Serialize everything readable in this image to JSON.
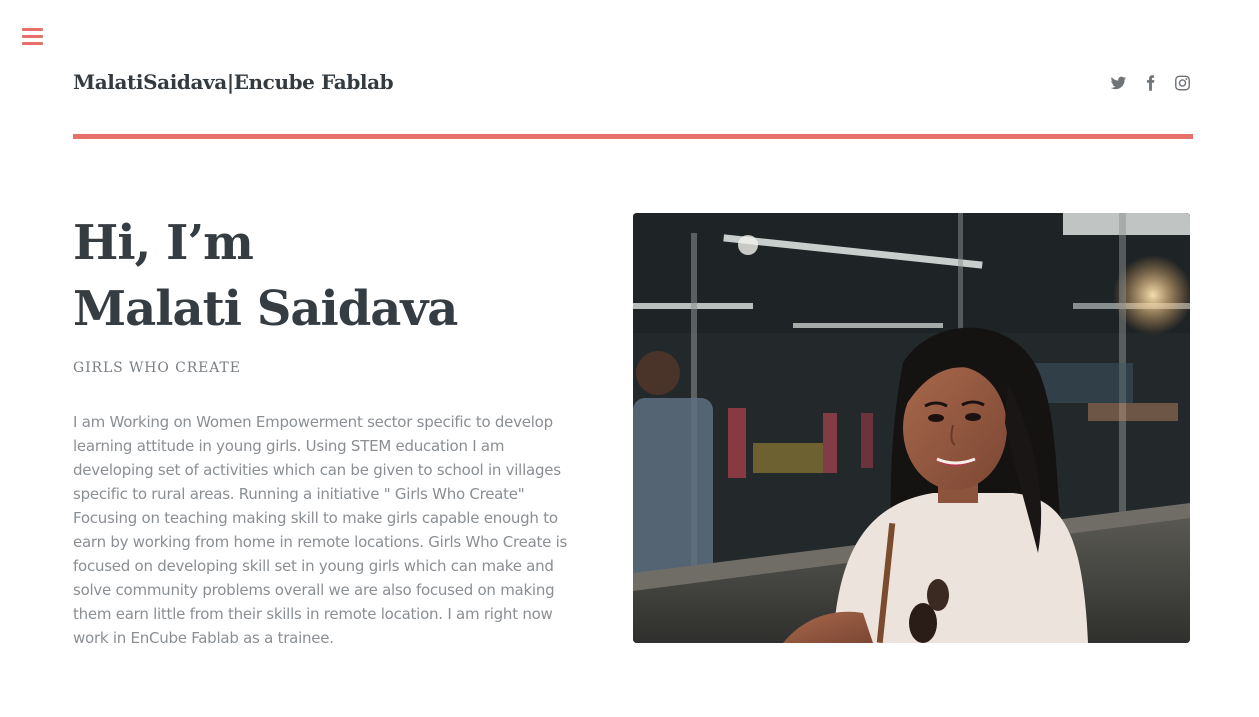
{
  "header": {
    "menu_icon": "hamburger-menu-icon",
    "site_title": "MalatiSaidava|Encube Fablab",
    "social_links": [
      {
        "icon": "twitter-icon",
        "label": "Twitter"
      },
      {
        "icon": "facebook-icon",
        "label": "Facebook"
      },
      {
        "icon": "instagram-icon",
        "label": "Instagram"
      }
    ]
  },
  "hero": {
    "greeting_line1": "Hi, I’m",
    "greeting_line2": "Malati Saidava",
    "tagline": "GIRLS WHO CREATE",
    "bio": "I am Working on Women Empowerment sector specific to develop learning attitude in young girls. Using STEM education I am developing set of activities which can be given to school in villages specific to rural areas. Running a initiative \" Girls Who Create\" Focusing on teaching making skill to make girls capable enough to earn by working from home in remote locations. Girls Who Create is focused on developing skill set in young girls which can make and solve community problems overall we are also focused on making them earn little from their skills in remote location. I am right now work in EnCube Fablab as a trainee."
  },
  "colors": {
    "accent": "#e8706a",
    "heading": "#353c42",
    "body_text": "#8a8f94",
    "icon": "#6f7479"
  }
}
